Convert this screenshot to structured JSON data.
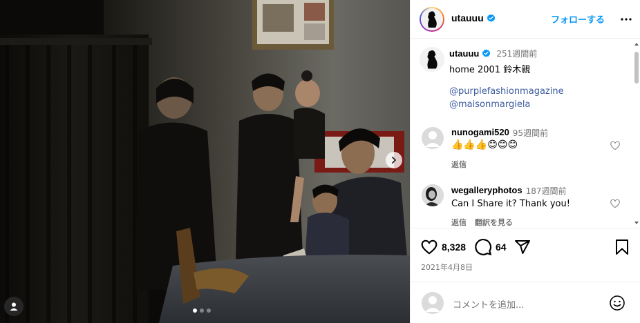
{
  "post": {
    "username": "utauuu",
    "follow_label": "フォローする",
    "caption": {
      "age": "251週間前",
      "line1": "home 2001 鈴木親",
      "mention1": "@purplefashionmagazine",
      "mention2": "@maisonmargiela"
    },
    "comments": [
      {
        "username": "nunogami520",
        "age": "95週間前",
        "text": "👍👍👍😊😊😊",
        "reply": "返信"
      },
      {
        "username": "wegalleryphotos",
        "age": "187週間前",
        "text": "Can I Share it? Thank you!",
        "reply": "返信",
        "translate": "翻訳を見る"
      }
    ],
    "likes": "8,328",
    "comment_count": "64",
    "date": "2021年4月8日",
    "composer_placeholder": "コメントを追加...",
    "carousel": {
      "count": 3,
      "active": 0
    }
  },
  "colors": {
    "accent": "#0095f6",
    "verified": "#0095f6",
    "muted": "#737373"
  }
}
